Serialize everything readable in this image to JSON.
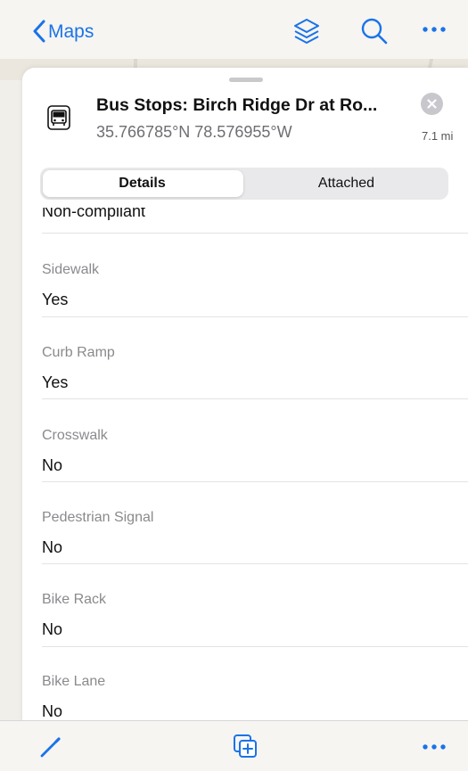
{
  "nav": {
    "back_label": "Maps",
    "icons": [
      "chevron-left-icon",
      "layers-icon",
      "search-icon",
      "more-icon"
    ]
  },
  "sheet": {
    "title": "Bus Stops: Birch Ridge Dr at Ro...",
    "coords": "35.766785°N  78.576955°W",
    "distance": "7.1 mi",
    "icon": "bus-icon",
    "tabs": [
      "Details",
      "Attached"
    ],
    "active_tab": "Details"
  },
  "details": {
    "partial_value": "Non-compliant",
    "fields": [
      {
        "label": "Sidewalk",
        "value": "Yes"
      },
      {
        "label": "Curb Ramp",
        "value": "Yes"
      },
      {
        "label": "Crosswalk",
        "value": "No"
      },
      {
        "label": "Pedestrian Signal",
        "value": "No"
      },
      {
        "label": "Bike Rack",
        "value": "No"
      },
      {
        "label": "Bike Lane",
        "value": "No"
      }
    ]
  },
  "toolbar": {
    "icons": [
      "edit-pencil-icon",
      "add-copy-icon",
      "more-icon"
    ]
  },
  "colors": {
    "accent": "#1a73e8",
    "secondary_text": "#8a8a8e"
  }
}
